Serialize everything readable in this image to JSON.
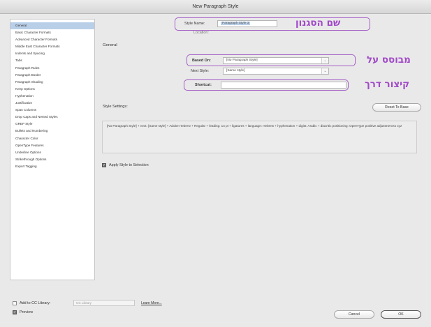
{
  "window": {
    "title": "New Paragraph Style"
  },
  "sidebar": {
    "items": [
      {
        "label": "General",
        "selected": true
      },
      {
        "label": "Basic Character Formats"
      },
      {
        "label": "Advanced Character Formats"
      },
      {
        "label": "Middle East Character Formats"
      },
      {
        "label": "Indents and Spacing"
      },
      {
        "label": "Tabs"
      },
      {
        "label": "Paragraph Rules"
      },
      {
        "label": "Paragraph Border"
      },
      {
        "label": "Paragraph Shading"
      },
      {
        "label": "Keep Options"
      },
      {
        "label": "Hyphenation"
      },
      {
        "label": "Justification"
      },
      {
        "label": "Span Columns"
      },
      {
        "label": "Drop Caps and Nested Styles"
      },
      {
        "label": "GREP Style"
      },
      {
        "label": "Bullets and Numbering"
      },
      {
        "label": "Character Color"
      },
      {
        "label": "OpenType Features"
      },
      {
        "label": "Underline Options"
      },
      {
        "label": "Strikethrough Options"
      },
      {
        "label": "Export Tagging"
      }
    ]
  },
  "form": {
    "style_name_label": "Style Name:",
    "style_name_value": "Paragraph Style 3",
    "location_label": "Location:",
    "section_title": "General",
    "based_on_label": "Based On:",
    "based_on_value": "[No Paragraph Style]",
    "next_style_label": "Next Style:",
    "next_style_value": "[Same style]",
    "shortcut_label": "Shortcut:",
    "shortcut_value": "",
    "style_settings_label": "Style Settings:",
    "reset_button": "Reset To Base",
    "style_settings_text": "[No Paragraph Style] + next: [Same style] + Adobe Hebrew + Regular + leading: 14 pt + ligatures + language: Hebrew + hyphenation + digits: Arabic + diacritic positioning: OpenType positive adjustment to xyz",
    "apply_label": "Apply Style to Selection",
    "apply_checked": true
  },
  "footer": {
    "cc_label": "Add to CC Library:",
    "cc_select": "CC Library",
    "learn_more": "Learn More...",
    "preview_label": "Preview",
    "preview_checked": true,
    "cancel": "Cancel",
    "ok": "OK"
  },
  "annotations": {
    "style_name": "שם הסגנון",
    "based_on": "מבוסס על",
    "shortcut": "קיצור דרך",
    "color": "#a14ac8"
  }
}
